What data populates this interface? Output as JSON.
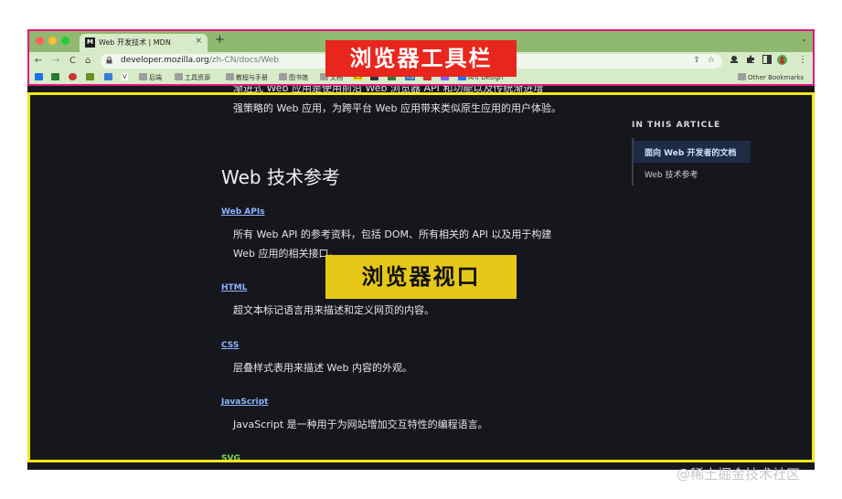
{
  "tab": {
    "favicon_text": "M",
    "title": "Web 开发技术 | MDN",
    "close_glyph": "×",
    "new_tab_glyph": "+",
    "dropdown_glyph": "⌄"
  },
  "toolbar": {
    "back": "←",
    "forward": "→",
    "reload": "C",
    "home": "⌂",
    "lock_glyph": "🔒",
    "url_host": "developer.mozilla.org",
    "url_path": "/zh-CN/docs/Web",
    "share_glyph": "⇪",
    "star_glyph": "☆",
    "menu_glyph": "⋮"
  },
  "bookmarks": [
    {
      "label": "",
      "color": "#1a73e8"
    },
    {
      "label": "",
      "color": "#2b7a2b"
    },
    {
      "label": "",
      "color": "#c0392b"
    },
    {
      "label": "",
      "color": "#6b8e23"
    },
    {
      "label": "",
      "color": "#3a7bd5"
    },
    {
      "label": "V",
      "color": "#ffffff"
    },
    {
      "label": "后端",
      "color": "#9e9e9e"
    },
    {
      "label": "工具资源",
      "color": "#9e9e9e"
    },
    {
      "label": "教程与手册",
      "color": "#9e9e9e"
    },
    {
      "label": "图书馆",
      "color": "#9e9e9e"
    },
    {
      "label": "文档",
      "color": "#9e9e9e"
    },
    {
      "label": "ES",
      "color": "#f7df1e"
    },
    {
      "label": "",
      "color": "#333333"
    },
    {
      "label": "",
      "color": "#2e7d32"
    },
    {
      "label": "TS",
      "color": "#3178c6"
    },
    {
      "label": "",
      "color": "#d32f2f"
    },
    {
      "label": "",
      "color": "#7b61ff"
    },
    {
      "label": "Ant Design",
      "color": "#1677ff"
    }
  ],
  "other_bookmarks": "Other Bookmarks",
  "annotations": {
    "chrome_label": "浏览器工具栏",
    "viewport_label": "浏览器视口",
    "chrome_outline_color": "#e0177f",
    "viewport_outline_color": "#f3e51a"
  },
  "content": {
    "intro_line1": "渐进式 Web 应用是使用前沿 Web 浏览器 API 和功能以及传统渐进增",
    "intro_line2": "强策略的 Web 应用，为跨平台 Web 应用带来类似原生应用的用户体验。",
    "heading": "Web 技术参考",
    "items": [
      {
        "term": "Web APIs",
        "desc1": "所有 Web API 的参考资料，包括 DOM、所有相关的 API 以及用于构建",
        "desc2": "Web 应用的相关接口。"
      },
      {
        "term": "HTML",
        "desc1": "超文本标记语言用来描述和定义网页的内容。",
        "desc2": ""
      },
      {
        "term": "CSS",
        "desc1": "层叠样式表用来描述 Web 内容的外观。",
        "desc2": ""
      },
      {
        "term": "JavaScript",
        "desc1": "JavaScript 是一种用于为网站增加交互特性的编程语言。",
        "desc2": ""
      },
      {
        "term": "SVG",
        "desc1": "",
        "desc2": ""
      }
    ]
  },
  "toc": {
    "heading": "IN THIS ARTICLE",
    "active": "面向 Web 开发者的文档",
    "item": "Web 技术参考"
  },
  "watermark": "@稀土掘金技术社区"
}
